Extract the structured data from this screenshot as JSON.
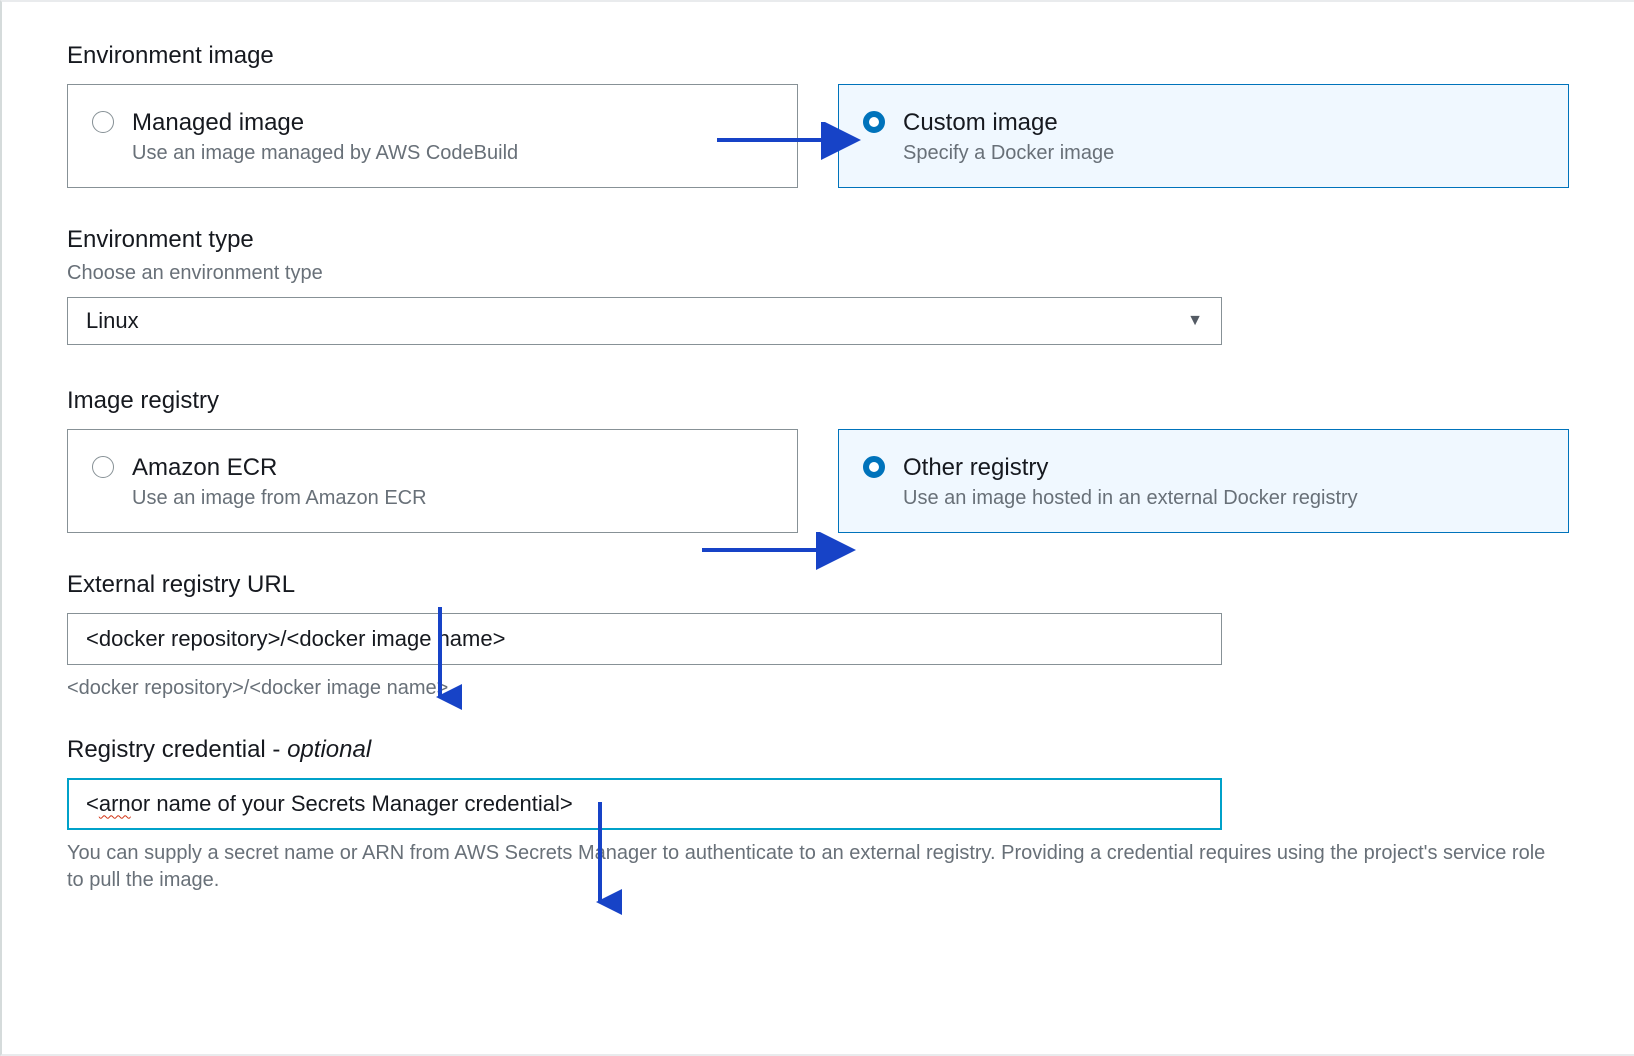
{
  "environment_image": {
    "label": "Environment image",
    "options": [
      {
        "title": "Managed image",
        "desc": "Use an image managed by AWS CodeBuild",
        "selected": false
      },
      {
        "title": "Custom image",
        "desc": "Specify a Docker image",
        "selected": true
      }
    ]
  },
  "environment_type": {
    "label": "Environment type",
    "sublabel": "Choose an environment type",
    "value": "Linux"
  },
  "image_registry": {
    "label": "Image registry",
    "options": [
      {
        "title": "Amazon ECR",
        "desc": "Use an image from Amazon ECR",
        "selected": false
      },
      {
        "title": "Other registry",
        "desc": "Use an image hosted in an external Docker registry",
        "selected": true
      }
    ]
  },
  "external_registry_url": {
    "label": "External registry URL",
    "value": "<docker repository>/<docker image name>",
    "helper": "<docker repository>/<docker image name>"
  },
  "registry_credential": {
    "label_main": "Registry credential",
    "label_suffix": " - ",
    "label_optional": "optional",
    "value_prefix": "<",
    "value_wavy": "arn",
    "value_rest": " or name of your Secrets Manager credential>",
    "helper": "You can supply a secret name or ARN from AWS Secrets Manager to authenticate to an external registry. Providing a credential requires using the project's service role to pull the image."
  },
  "colors": {
    "accent": "#0073bb",
    "focus": "#00a1c9",
    "arrow": "#1743c7"
  }
}
